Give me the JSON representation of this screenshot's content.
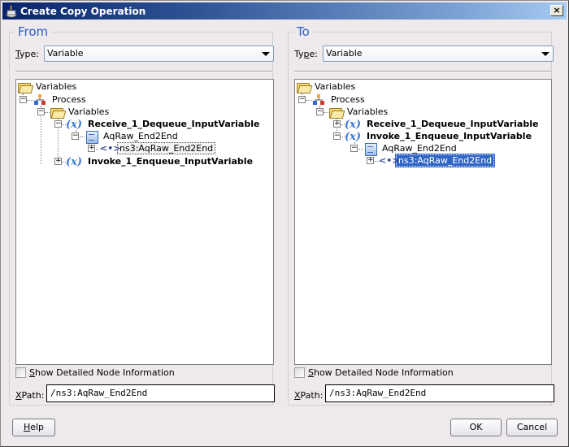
{
  "window": {
    "title": "Create Copy Operation",
    "close_glyph": "×"
  },
  "from": {
    "legend": "From",
    "type_label_prefix": "T",
    "type_label_rest": "ype:",
    "type_value": "Variable",
    "tree": [
      {
        "label": "Variables",
        "icon": "folder-icon",
        "bold": false
      },
      {
        "label": "Process",
        "icon": "process-icon",
        "bold": false,
        "expander": "−"
      },
      {
        "label": "Variables",
        "icon": "folder-icon",
        "bold": false,
        "expander": "−"
      },
      {
        "label": "Receive_1_Dequeue_InputVariable",
        "icon": "variable-icon",
        "bold": true,
        "expander": "−"
      },
      {
        "label": "AqRaw_End2End",
        "icon": "message-part-icon",
        "bold": false,
        "expander": "−"
      },
      {
        "label": "ns3:AqRaw_End2End",
        "icon": "element-icon",
        "bold": false,
        "expander": "+",
        "state": "focused"
      },
      {
        "label": "Invoke_1_Enqueue_InputVariable",
        "icon": "variable-icon",
        "bold": true,
        "expander": "+"
      }
    ],
    "show_detail_label_prefix": "S",
    "show_detail_label_rest": "how Detailed Node Information",
    "show_detail_checked": false,
    "xpath_label_prefix": "X",
    "xpath_label_rest": "Path:",
    "xpath_value": "/ns3:AqRaw_End2End"
  },
  "to": {
    "legend": "To",
    "type_label_prefix": "Ty",
    "type_label_u": "p",
    "type_label_rest": "e:",
    "type_value": "Variable",
    "tree": [
      {
        "label": "Variables",
        "icon": "folder-icon",
        "bold": false
      },
      {
        "label": "Process",
        "icon": "process-icon",
        "bold": false,
        "expander": "−"
      },
      {
        "label": "Variables",
        "icon": "folder-icon",
        "bold": false,
        "expander": "−"
      },
      {
        "label": "Receive_1_Dequeue_InputVariable",
        "icon": "variable-icon",
        "bold": true,
        "expander": "+"
      },
      {
        "label": "Invoke_1_Enqueue_InputVariable",
        "icon": "variable-icon",
        "bold": true,
        "expander": "−"
      },
      {
        "label": "AqRaw_End2End",
        "icon": "message-part-icon",
        "bold": false,
        "expander": "−"
      },
      {
        "label": "ns3:AqRaw_End2End",
        "icon": "element-icon",
        "bold": false,
        "expander": "+",
        "state": "selected"
      }
    ],
    "show_detail_label_prefix": "S",
    "show_detail_label_rest": "how Detailed Node Information",
    "show_detail_checked": false,
    "xpath_label_prefix": "X",
    "xpath_label_rest": "Path:",
    "xpath_value": "/ns3:AqRaw_End2End"
  },
  "buttons": {
    "help_prefix": "H",
    "help_rest": "elp",
    "ok": "OK",
    "cancel": "Cancel"
  },
  "glyphs": {
    "variable": "(x)",
    "element": "<•>",
    "expand": "+",
    "collapse": "−"
  },
  "colors": {
    "accent": "#2a62c2",
    "selection": "#3165c5",
    "title_start": "#0a246a",
    "title_end": "#a6caf0"
  }
}
